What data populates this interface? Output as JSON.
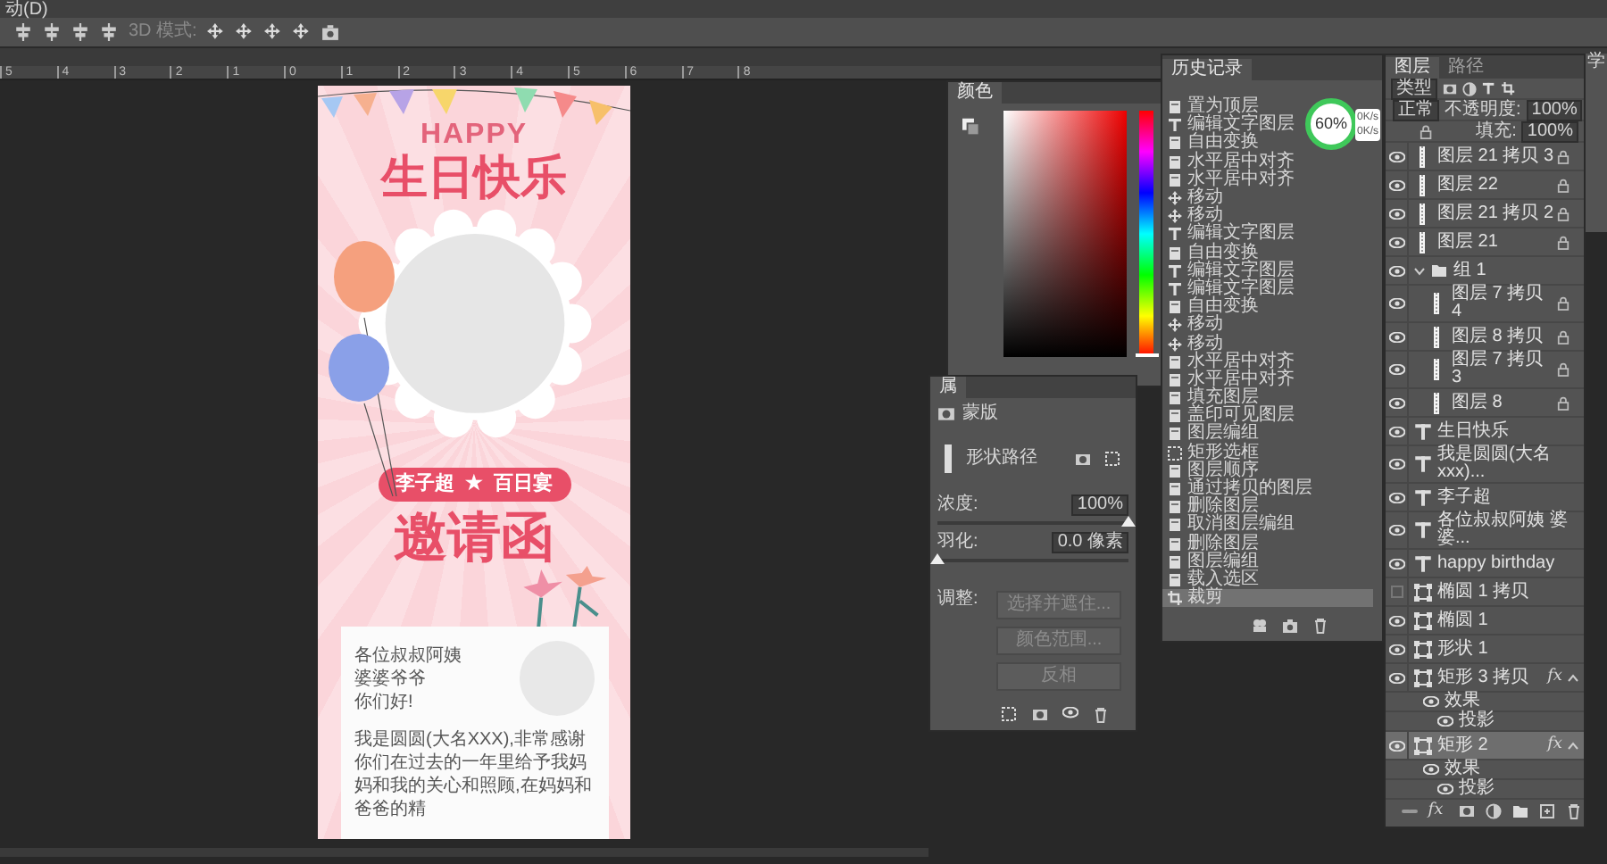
{
  "menu_bar": {
    "title": "动(D)"
  },
  "options_bar": {
    "mode_label": "3D 模式:"
  },
  "ruler": {
    "labels": [
      "5",
      "4",
      "3",
      "2",
      "1",
      "0",
      "1",
      "2",
      "3",
      "4",
      "5",
      "6",
      "7",
      "8"
    ]
  },
  "poster": {
    "happy": "HAPPY",
    "title": "生日快乐",
    "badge_name": "李子超",
    "badge_star": "★",
    "badge_event": "百日宴",
    "heading": "邀请函",
    "greeting_lines": [
      "各位叔叔阿姨",
      "婆婆爷爷",
      "你们好!"
    ],
    "body": "我是圆圆(大名XXX),非常感谢你们在过去的一年里给予我妈妈和我的关心和照顾,在妈妈和爸爸的精"
  },
  "color_panel": {
    "title": "颜色",
    "hue_slider": {
      "level": 0
    }
  },
  "properties_panel": {
    "title": "属",
    "section": "蒙版",
    "path_label": "形状路径",
    "density": {
      "label": "浓度:",
      "value": "100%",
      "level": 1
    },
    "feather": {
      "label": "羽化:",
      "value": "0.0 像素",
      "level": 0
    },
    "adjust_label": "调整:",
    "buttons": [
      {
        "label": "选择并遮住...",
        "disabled": true
      },
      {
        "label": "颜色范围...",
        "disabled": true
      },
      {
        "label": "反相",
        "disabled": true
      }
    ]
  },
  "history_panel": {
    "title": "历史记录",
    "items": [
      {
        "label": "置为顶层",
        "kind": "doc",
        "selected": false
      },
      {
        "label": "编辑文字图层",
        "kind": "text",
        "selected": false
      },
      {
        "label": "自由变换",
        "kind": "doc",
        "selected": false
      },
      {
        "label": "水平居中对齐",
        "kind": "doc",
        "selected": false
      },
      {
        "label": "水平居中对齐",
        "kind": "doc",
        "selected": false
      },
      {
        "label": "移动",
        "kind": "move",
        "selected": false
      },
      {
        "label": "移动",
        "kind": "move",
        "selected": false
      },
      {
        "label": "编辑文字图层",
        "kind": "text",
        "selected": false
      },
      {
        "label": "自由变换",
        "kind": "doc",
        "selected": false
      },
      {
        "label": "编辑文字图层",
        "kind": "text",
        "selected": false
      },
      {
        "label": "编辑文字图层",
        "kind": "text",
        "selected": false
      },
      {
        "label": "自由变换",
        "kind": "doc",
        "selected": false
      },
      {
        "label": "移动",
        "kind": "move",
        "selected": false
      },
      {
        "label": "移动",
        "kind": "move",
        "selected": false
      },
      {
        "label": "水平居中对齐",
        "kind": "doc",
        "selected": false
      },
      {
        "label": "水平居中对齐",
        "kind": "doc",
        "selected": false
      },
      {
        "label": "填充图层",
        "kind": "doc",
        "selected": false
      },
      {
        "label": "盖印可见图层",
        "kind": "doc",
        "selected": false
      },
      {
        "label": "图层编组",
        "kind": "doc",
        "selected": false
      },
      {
        "label": "矩形选框",
        "kind": "marquee",
        "selected": false
      },
      {
        "label": "图层顺序",
        "kind": "doc",
        "selected": false
      },
      {
        "label": "通过拷贝的图层",
        "kind": "doc",
        "selected": false
      },
      {
        "label": "删除图层",
        "kind": "doc",
        "selected": false
      },
      {
        "label": "取消图层编组",
        "kind": "doc",
        "selected": false
      },
      {
        "label": "删除图层",
        "kind": "doc",
        "selected": false
      },
      {
        "label": "图层编组",
        "kind": "doc",
        "selected": false
      },
      {
        "label": "载入选区",
        "kind": "doc",
        "selected": false
      },
      {
        "label": "裁剪",
        "kind": "crop",
        "selected": true
      }
    ]
  },
  "speed_widget": {
    "percent": "60%",
    "upload": "0K/s",
    "download": "0K/s"
  },
  "layers_panel": {
    "tabs": [
      {
        "label": "图层",
        "selected": true
      },
      {
        "label": "路径",
        "selected": false
      }
    ],
    "filter": "类型",
    "blend_mode": "正常",
    "opacity_label": "不透明度:",
    "opacity": "100%",
    "fill_label": "填充:",
    "fill": "100%",
    "footer_fx": "fx",
    "layers": [
      {
        "name": "图层 21 拷贝 3",
        "kind": "pixel",
        "visible": true,
        "locked": true,
        "selected": false
      },
      {
        "name": "图层 22",
        "kind": "pixel",
        "visible": true,
        "locked": true,
        "selected": false
      },
      {
        "name": "图层 21 拷贝 2",
        "kind": "pixel",
        "visible": true,
        "locked": true,
        "selected": false
      },
      {
        "name": "图层 21",
        "kind": "pixel",
        "visible": true,
        "locked": true,
        "selected": false
      },
      {
        "name": "组 1",
        "kind": "group",
        "visible": true,
        "locked": false,
        "selected": false,
        "expanded": true,
        "children": [
          {
            "name": "图层 7 拷贝 4",
            "kind": "pixel",
            "visible": true,
            "locked": true,
            "selected": false
          },
          {
            "name": "图层 8 拷贝",
            "kind": "pixel",
            "visible": true,
            "locked": true,
            "selected": false
          },
          {
            "name": "图层 7 拷贝 3",
            "kind": "pixel",
            "visible": true,
            "locked": true,
            "selected": false
          },
          {
            "name": "图层 8",
            "kind": "pixel",
            "visible": true,
            "locked": true,
            "selected": false
          }
        ]
      },
      {
        "name": "生日快乐",
        "kind": "text",
        "visible": true,
        "locked": false,
        "selected": false
      },
      {
        "name": "我是圆圆(大名xxx)...",
        "kind": "text",
        "visible": true,
        "locked": false,
        "selected": false
      },
      {
        "name": "李子超",
        "kind": "text",
        "visible": true,
        "locked": false,
        "selected": false
      },
      {
        "name": "各位叔叔阿姨 婆婆...",
        "kind": "text",
        "visible": true,
        "locked": false,
        "selected": false
      },
      {
        "name": "happy birthday",
        "kind": "text",
        "visible": true,
        "locked": false,
        "selected": false
      },
      {
        "name": "椭圆 1 拷贝",
        "kind": "shape",
        "visible": false,
        "locked": false,
        "selected": false
      },
      {
        "name": "椭圆 1",
        "kind": "shape",
        "visible": true,
        "locked": false,
        "selected": false
      },
      {
        "name": "形状 1",
        "kind": "shape",
        "visible": true,
        "locked": false,
        "selected": false
      },
      {
        "name": "矩形 3 拷贝",
        "kind": "shape",
        "visible": true,
        "locked": false,
        "selected": false,
        "fx": "fx",
        "expanded": true,
        "children": [
          {
            "name": "效果",
            "kind": "effects",
            "visible": true,
            "locked": false,
            "selected": false
          },
          {
            "name": "投影",
            "kind": "effect",
            "visible": true,
            "locked": false,
            "selected": false
          }
        ]
      },
      {
        "name": "矩形 2",
        "kind": "shape",
        "visible": true,
        "locked": false,
        "selected": true,
        "fx": "fx",
        "expanded": true,
        "children": [
          {
            "name": "效果",
            "kind": "effects",
            "visible": true,
            "locked": false,
            "selected": false
          },
          {
            "name": "投影",
            "kind": "effect",
            "visible": true,
            "locked": false,
            "selected": false
          }
        ]
      }
    ]
  },
  "learn_panel": {
    "tab": "学"
  }
}
